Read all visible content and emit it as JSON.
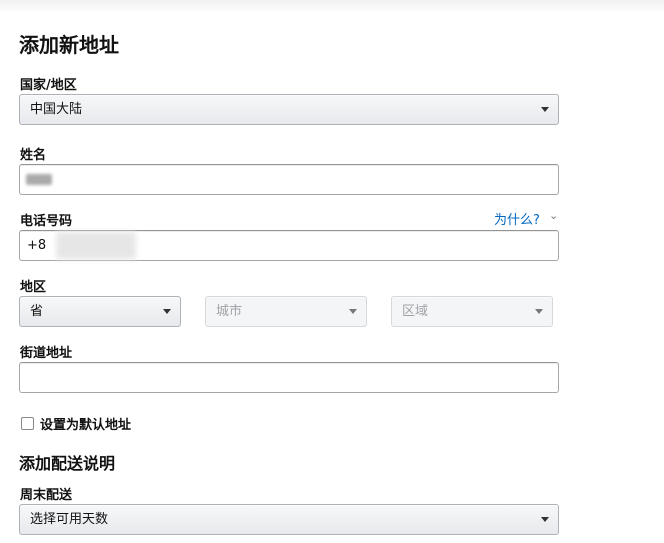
{
  "page": {
    "title": "添加新地址"
  },
  "country": {
    "label": "国家/地区",
    "selected": "中国大陆"
  },
  "name": {
    "label": "姓名",
    "value": ""
  },
  "phone": {
    "label": "电话号码",
    "why_link": "为什么?",
    "value_prefix": "+8"
  },
  "region": {
    "label": "地区",
    "province": "省",
    "city": "城市",
    "district": "区域"
  },
  "street": {
    "label": "街道地址",
    "value": ""
  },
  "default_address": {
    "label": "设置为默认地址",
    "checked": false
  },
  "delivery": {
    "section_title": "添加配送说明",
    "weekend_label": "周末配送",
    "weekend_selected": "选择可用天数"
  },
  "icons": {
    "caret": "chevron-down-icon"
  }
}
